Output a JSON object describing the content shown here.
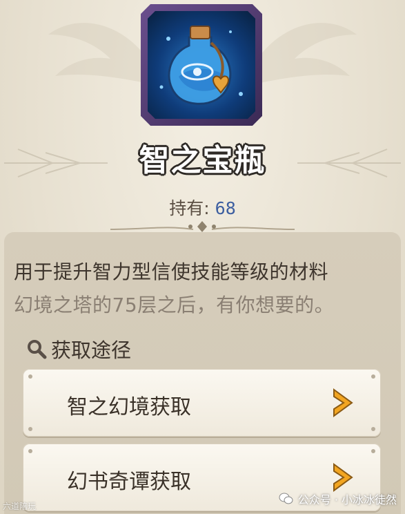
{
  "item": {
    "name": "智之宝瓶",
    "hold_label": "持有:",
    "hold_count": "68"
  },
  "description": {
    "line1": "用于提升智力型信使技能等级的材料",
    "line2": "幻境之塔的75层之后，有你想要的。"
  },
  "acquire": {
    "title": "获取途径",
    "options": [
      {
        "label": "智之幻境获取"
      },
      {
        "label": "幻书奇谭获取"
      }
    ]
  },
  "watermark": {
    "right": "公众号 · 小冰冰徒然",
    "left": "六道陪玩"
  },
  "colors": {
    "accent_count": "#3c5ea0",
    "arrow": "#f0a020",
    "frame": "#5b4580"
  }
}
